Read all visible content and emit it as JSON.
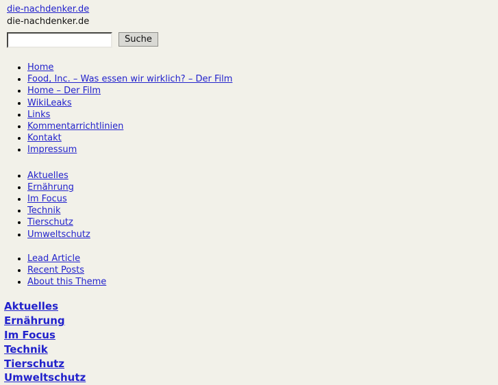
{
  "page": {
    "background_color": "#f2f1e9",
    "link_color": "#2222cc",
    "text_color": "#000000"
  },
  "header": {
    "site_title_link": "die-nachdenker.de",
    "site_title_text": "die-nachdenker.de"
  },
  "search": {
    "value": "",
    "placeholder": "",
    "button_label": "Suche"
  },
  "nav_primary": {
    "items": [
      {
        "label": "Home"
      },
      {
        "label": "Food, Inc. – Was essen wir wirklich? – Der Film"
      },
      {
        "label": "Home – Der Film"
      },
      {
        "label": "WikiLeaks"
      },
      {
        "label": "Links"
      },
      {
        "label": "Kommentarrichtlinien"
      },
      {
        "label": "Kontakt"
      },
      {
        "label": "Impressum"
      }
    ]
  },
  "nav_categories": {
    "items": [
      {
        "label": "Aktuelles"
      },
      {
        "label": "Ernährung"
      },
      {
        "label": "Im Focus"
      },
      {
        "label": "Technik"
      },
      {
        "label": "Tierschutz"
      },
      {
        "label": "Umweltschutz"
      }
    ]
  },
  "nav_meta": {
    "items": [
      {
        "label": "Lead Article"
      },
      {
        "label": "Recent Posts"
      },
      {
        "label": "About this Theme"
      }
    ]
  },
  "section_headings": {
    "items": [
      {
        "label": "Aktuelles"
      },
      {
        "label": "Ernährung"
      },
      {
        "label": "Im Focus"
      },
      {
        "label": "Technik"
      },
      {
        "label": "Tierschutz"
      },
      {
        "label": "Umweltschutz"
      }
    ]
  }
}
